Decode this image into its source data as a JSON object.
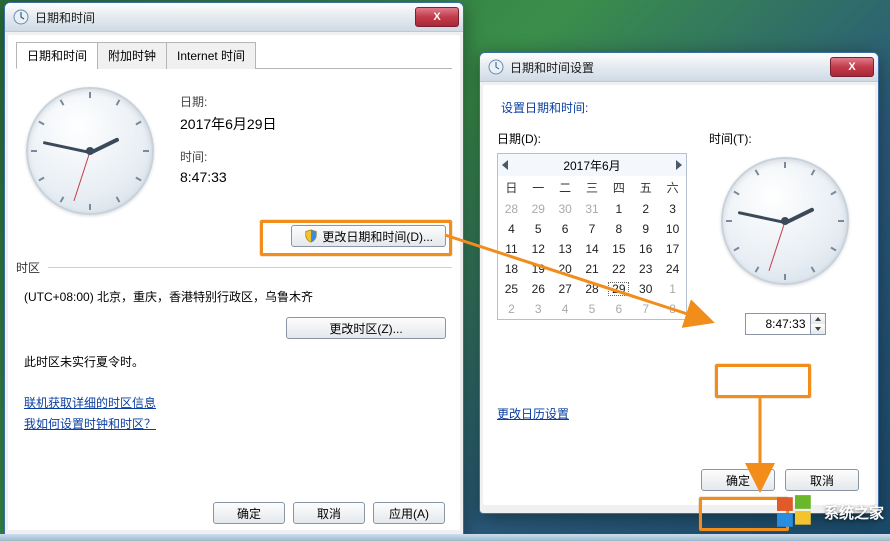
{
  "main_window": {
    "title": "日期和时间",
    "tabs": [
      "日期和时间",
      "附加时钟",
      "Internet 时间"
    ],
    "date_label": "日期:",
    "date_value": "2017年6月29日",
    "time_label": "时间:",
    "time_value": "8:47:33",
    "change_dt_btn": "更改日期和时间(D)...",
    "tz_header": "时区",
    "tz_value": "(UTC+08:00) 北京，重庆，香港特别行政区，乌鲁木齐",
    "change_tz_btn": "更改时区(Z)...",
    "dst_note": "此时区未实行夏令时。",
    "link1": "联机获取详细的时区信息",
    "link2": "我如何设置时钟和时区？",
    "ok_btn": "确定",
    "cancel_btn": "取消",
    "apply_btn": "应用(A)"
  },
  "settings_window": {
    "title": "日期和时间设置",
    "header": "设置日期和时间:",
    "date_label": "日期(D):",
    "time_label": "时间(T):",
    "cal_month": "2017年6月",
    "dow": [
      "日",
      "一",
      "二",
      "三",
      "四",
      "五",
      "六"
    ],
    "days": [
      {
        "n": 28,
        "out": true
      },
      {
        "n": 29,
        "out": true
      },
      {
        "n": 30,
        "out": true
      },
      {
        "n": 31,
        "out": true
      },
      {
        "n": 1
      },
      {
        "n": 2
      },
      {
        "n": 3
      },
      {
        "n": 4
      },
      {
        "n": 5
      },
      {
        "n": 6
      },
      {
        "n": 7
      },
      {
        "n": 8
      },
      {
        "n": 9
      },
      {
        "n": 10
      },
      {
        "n": 11
      },
      {
        "n": 12
      },
      {
        "n": 13
      },
      {
        "n": 14
      },
      {
        "n": 15
      },
      {
        "n": 16
      },
      {
        "n": 17
      },
      {
        "n": 18
      },
      {
        "n": 19
      },
      {
        "n": 20
      },
      {
        "n": 21
      },
      {
        "n": 22
      },
      {
        "n": 23
      },
      {
        "n": 24
      },
      {
        "n": 25
      },
      {
        "n": 26
      },
      {
        "n": 27
      },
      {
        "n": 28
      },
      {
        "n": 29,
        "today": true
      },
      {
        "n": 30
      },
      {
        "n": 1,
        "out": true
      },
      {
        "n": 2,
        "out": true
      },
      {
        "n": 3,
        "out": true
      },
      {
        "n": 4,
        "out": true
      },
      {
        "n": 5,
        "out": true
      },
      {
        "n": 6,
        "out": true
      },
      {
        "n": 7,
        "out": true
      },
      {
        "n": 8,
        "out": true
      }
    ],
    "time_value": "8:47:33",
    "cal_link": "更改日历设置",
    "ok_btn": "确定",
    "cancel_btn": "取消"
  },
  "watermark": "系统之家"
}
